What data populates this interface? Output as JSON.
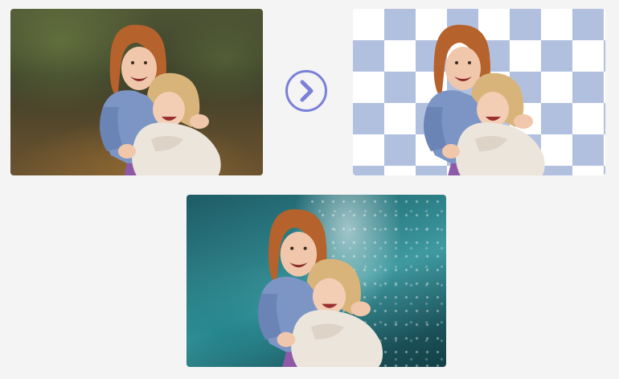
{
  "colors": {
    "background": "#f4f4f4",
    "accent": "#7a80d8",
    "checker_blue": "#b2c0df",
    "checker_white": "#ffffff"
  },
  "icons": {
    "arrow": "chevron-right-icon"
  },
  "panels": {
    "original": "photo-original",
    "cutout": "photo-background-removed",
    "result": "photo-new-background"
  }
}
